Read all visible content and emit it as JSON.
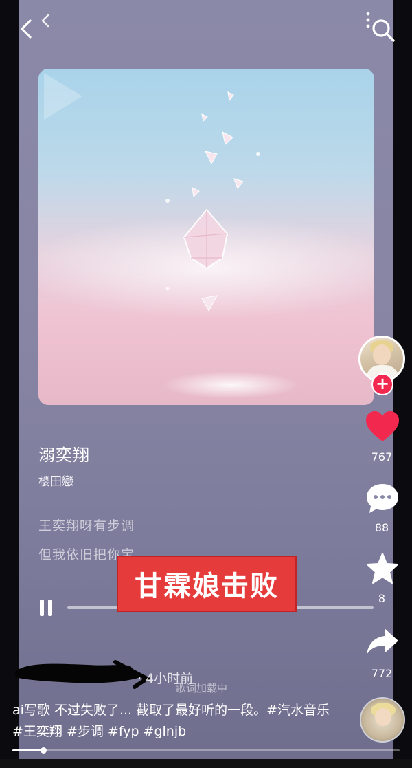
{
  "song": {
    "title": "溺奕翔",
    "artist": "樱田戀"
  },
  "lyrics": {
    "line1": "王奕翔呀有步调",
    "line2": "但我依旧把你宝"
  },
  "banner": {
    "text": "甘霖娘击败"
  },
  "rail": {
    "like_count": "767",
    "comment_count": "88",
    "favorite_count": "8",
    "share_count": "772"
  },
  "author": {
    "time": "· 4小时前",
    "loading": "歌词加载中"
  },
  "caption": {
    "text": "ai写歌 不过失败了... 截取了最好听的一段。#汽水音乐 #王奕翔 #步调 #fyp #glnjb"
  },
  "video": {
    "progress": 0.08
  },
  "colors": {
    "like_red": "#f3284f",
    "banner_red": "#e63b3b",
    "background": "#8a89a7"
  },
  "icons": [
    "back-icon",
    "search-icon",
    "more-icon",
    "heart-icon",
    "comment-icon",
    "star-icon",
    "share-icon",
    "pause-icon",
    "plus-icon",
    "play-icon"
  ]
}
